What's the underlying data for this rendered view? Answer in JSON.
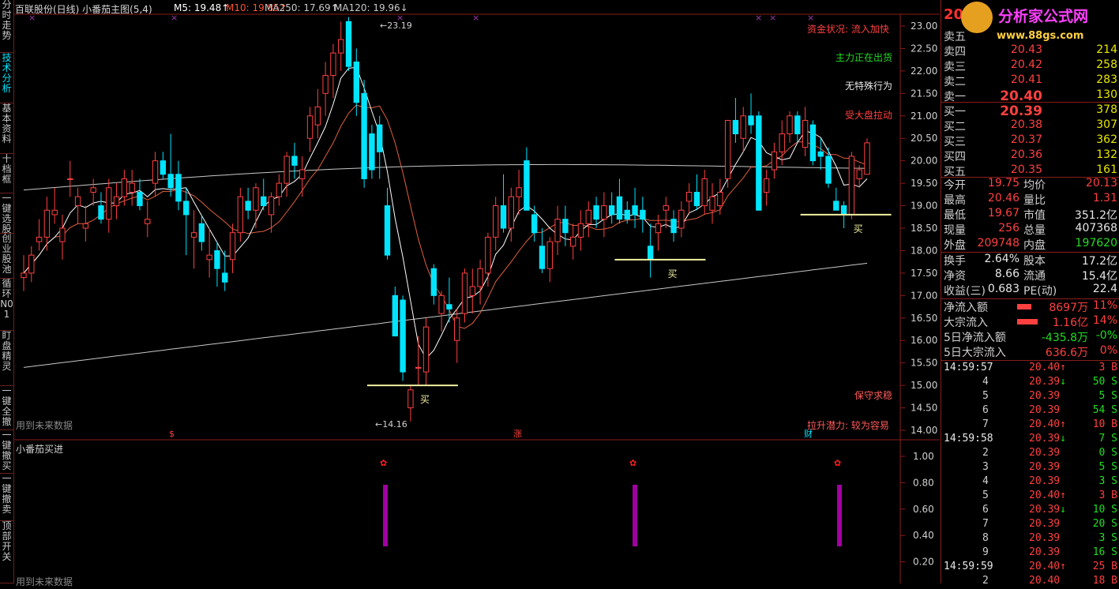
{
  "nav": [
    "分时走势",
    "技术分析",
    "基本资料",
    "十档框",
    "一键选股",
    "创业股池",
    "循环N01",
    "盯盘精灵",
    "一键全撤",
    "一键撤买",
    "一键撤卖",
    "顶部开关"
  ],
  "main": {
    "title": "百联股份(日线) 小番茄主图(5,4)",
    "ma5": "M5: 19.48↑",
    "ma10": "M10: 19.85↑",
    "ma250": "MA250: 17.69↑",
    "ma120": "MA120: 19.96↓",
    "high_label": "23.19",
    "low_label": "14.16",
    "buy_label": "买",
    "future_note": "用到未来数据",
    "fund_status": "资金状况: 流入加快",
    "main_force": "主力正在出货",
    "no_special": "无特殊行为",
    "market_pull": "受大盘拉动",
    "keep": "保守求稳",
    "potential": "拉升潜力: 较为容易",
    "axis_marks": [
      "$",
      "涨",
      "财"
    ],
    "price_ticks": [
      "23.00",
      "22.50",
      "22.00",
      "21.50",
      "21.00",
      "20.50",
      "20.00",
      "19.50",
      "19.00",
      "18.50",
      "18.00",
      "17.50",
      "17.00",
      "16.50",
      "16.00",
      "15.50",
      "15.00",
      "14.50",
      "14.00"
    ]
  },
  "sub": {
    "title": "小番茄买进",
    "ticks": [
      "1.00",
      "0.80",
      "0.60",
      "0.40",
      "0.20"
    ],
    "future_note": "用到未来数据"
  },
  "logo": {
    "text": "分析家公式网",
    "url": "www.88gs.com",
    "price_stub": "20"
  },
  "colors": {
    "up": "#ff4040",
    "down": "#00e5ff",
    "buy_bar": "#a000a0",
    "ma120": "#c8c8c8",
    "ma5": "#ffffff",
    "ma10": "#e06040"
  },
  "orderbook": {
    "asks": [
      {
        "label": "卖五",
        "price": "",
        "vol": ""
      },
      {
        "label": "卖四",
        "price": "20.43",
        "vol": "214"
      },
      {
        "label": "卖三",
        "price": "20.42",
        "vol": "258"
      },
      {
        "label": "卖二",
        "price": "20.41",
        "vol": "283"
      },
      {
        "label": "卖一",
        "price": "20.40",
        "vol": "130"
      }
    ],
    "bids": [
      {
        "label": "买一",
        "price": "20.39",
        "vol": "378"
      },
      {
        "label": "买二",
        "price": "20.38",
        "vol": "307"
      },
      {
        "label": "买三",
        "price": "20.37",
        "vol": "362"
      },
      {
        "label": "买四",
        "price": "20.36",
        "vol": "132"
      },
      {
        "label": "买五",
        "price": "20.35",
        "vol": "161"
      }
    ]
  },
  "stats": [
    {
      "l1": "今开",
      "v1": "19.75",
      "c1": "red",
      "l2": "均价",
      "v2": "20.13",
      "c2": "red"
    },
    {
      "l1": "最高",
      "v1": "20.46",
      "c1": "red",
      "l2": "量比",
      "v2": "1.31",
      "c2": "red"
    },
    {
      "l1": "最低",
      "v1": "19.67",
      "c1": "red",
      "l2": "市值",
      "v2": "351.2亿",
      "c2": "white"
    },
    {
      "l1": "现量",
      "v1": "256",
      "c1": "red",
      "l2": "总量",
      "v2": "407368",
      "c2": "white"
    },
    {
      "l1": "外盘",
      "v1": "209748",
      "c1": "red",
      "l2": "内盘",
      "v2": "197620",
      "c2": "green"
    }
  ],
  "stats2": [
    {
      "l1": "换手",
      "v1": "2.64%",
      "l2": "股本",
      "v2": "17.2亿"
    },
    {
      "l1": "净资",
      "v1": "8.66",
      "l2": "流通",
      "v2": "15.4亿"
    },
    {
      "l1": "收益(三)",
      "v1": "0.683",
      "l2": "PE(动)",
      "v2": "22.4"
    }
  ],
  "flows": [
    {
      "label": "净流入额",
      "value": "8697万",
      "pct": "11%",
      "c": "red",
      "bar": true
    },
    {
      "label": "大宗流入",
      "value": "1.16亿",
      "pct": "14%",
      "c": "red",
      "bar": true
    },
    {
      "label": "5日净流入额",
      "value": "-435.8万",
      "pct": "-0%",
      "c": "green",
      "bar": false
    },
    {
      "label": "5日大宗流入",
      "value": "636.6万",
      "pct": "0%",
      "c": "red",
      "bar": false
    }
  ],
  "ticks": [
    {
      "t": "14:59:57",
      "p": "20.40",
      "d": "up",
      "v": "3",
      "s": "B"
    },
    {
      "t": "4",
      "p": "20.39",
      "d": "down",
      "v": "50",
      "s": "S"
    },
    {
      "t": "5",
      "p": "20.39",
      "d": "",
      "v": "5",
      "s": "S"
    },
    {
      "t": "6",
      "p": "20.39",
      "d": "",
      "v": "54",
      "s": "S"
    },
    {
      "t": "7",
      "p": "20.40",
      "d": "up",
      "v": "10",
      "s": "B"
    },
    {
      "t": "14:59:58",
      "p": "20.39",
      "d": "down",
      "v": "7",
      "s": "S"
    },
    {
      "t": "2",
      "p": "20.39",
      "d": "",
      "v": "0",
      "s": "S"
    },
    {
      "t": "3",
      "p": "20.39",
      "d": "",
      "v": "5",
      "s": "S"
    },
    {
      "t": "4",
      "p": "20.39",
      "d": "",
      "v": "3",
      "s": "S"
    },
    {
      "t": "5",
      "p": "20.40",
      "d": "up",
      "v": "3",
      "s": "B"
    },
    {
      "t": "6",
      "p": "20.39",
      "d": "down",
      "v": "10",
      "s": "S"
    },
    {
      "t": "7",
      "p": "20.39",
      "d": "",
      "v": "20",
      "s": "S"
    },
    {
      "t": "8",
      "p": "20.39",
      "d": "",
      "v": "3",
      "s": "S"
    },
    {
      "t": "9",
      "p": "20.39",
      "d": "",
      "v": "16",
      "s": "S"
    },
    {
      "t": "14:59:59",
      "p": "20.40",
      "d": "up",
      "v": "25",
      "s": "B"
    },
    {
      "t": "2",
      "p": "20.40",
      "d": "",
      "v": "18",
      "s": "B"
    }
  ]
}
